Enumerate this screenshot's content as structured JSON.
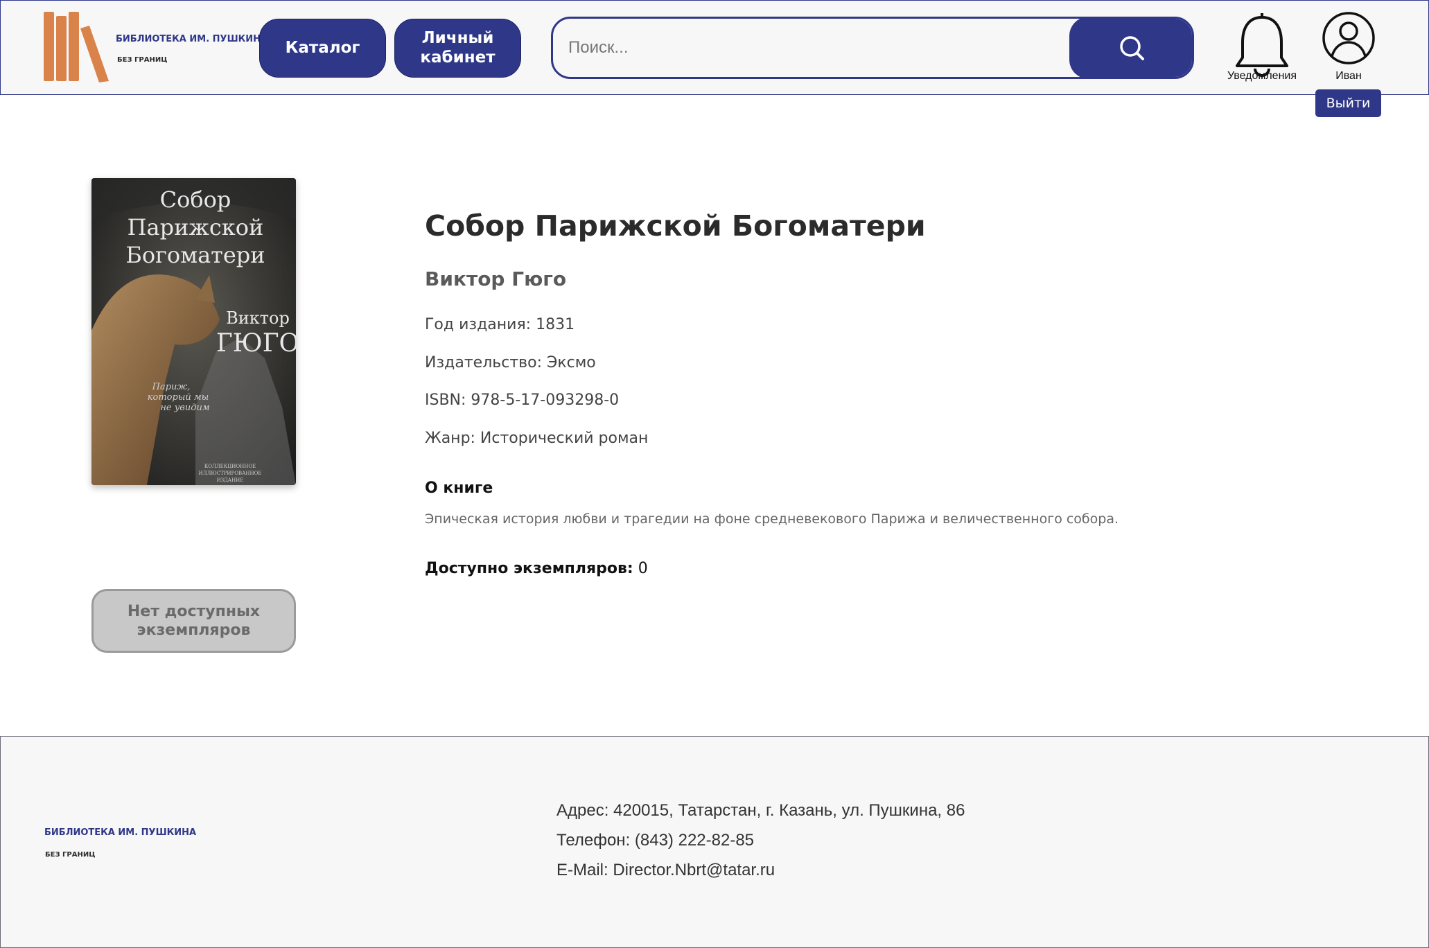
{
  "header": {
    "logo_line1": "БИБЛИОТЕКА ИМ. ПУШКИНА",
    "logo_line2": "БЕЗ ГРАНИЦ",
    "nav": {
      "catalog": "Каталог",
      "cabinet": "Личный кабинет"
    },
    "search": {
      "placeholder": "Поиск...",
      "value": ""
    },
    "notifications_label": "Уведомления",
    "user_name": "Иван",
    "logout_label": "Выйти",
    "brand_color": "#2f3888",
    "books_color": "#d9834a"
  },
  "book": {
    "title": "Собор Парижской Богоматери",
    "author": "Виктор Гюго",
    "year": "Год издания: 1831",
    "publisher": "Издательство: Эксмо",
    "isbn": "ISBN: 978-5-17-093298-0",
    "genre": "Жанр: Исторический роман",
    "about_heading": "О книге",
    "about_text": "Эпическая история любви и трагедии на фоне средневекового Парижа и величественного собора.",
    "available_label": "Доступно экземпляров:",
    "available_count": "0",
    "unavailable_button": "Нет доступных экземпляров",
    "cover": {
      "title_lines": [
        "Собор",
        "Парижской",
        "Богоматери"
      ],
      "author_lines": [
        "Виктор",
        "ГЮГО"
      ],
      "tagline_lines": [
        "Париж,",
        "который мы",
        "не увидим"
      ],
      "edition_lines": [
        "КОЛЛЕКЦИОННОЕ",
        "ИЛЛЮСТРИРОВАННОЕ",
        "ИЗДАНИЕ"
      ]
    }
  },
  "footer": {
    "logo_line1": "БИБЛИОТЕКА ИМ. ПУШКИНА",
    "logo_line2": "БЕЗ ГРАНИЦ",
    "address": "Адрес: 420015, Татарстан, г. Казань, ул. Пушкина, 86",
    "phone": "Телефон: (843) 222-82-85",
    "email": "E-Mail: Director.Nbrt@tatar.ru"
  }
}
